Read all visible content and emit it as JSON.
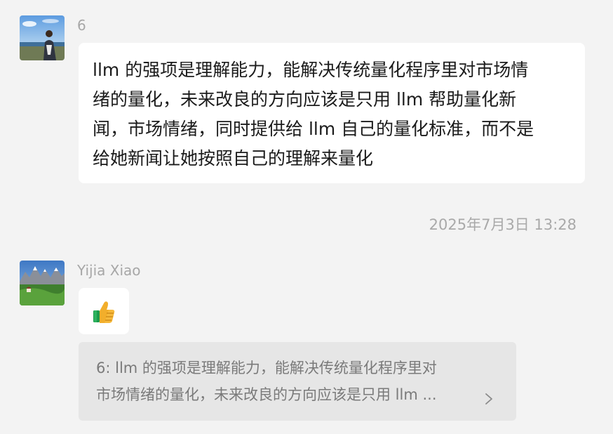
{
  "messages": [
    {
      "sender": "6",
      "text": "llm的强项是理解能力，能解决传统量化程序里对市场情绪的量化，未来改良的方向应该是只用 llm 帮助量化新闻，市场情绪，同时提供给 llm 自己的量化标准，而不是给她新闻让她按照自己的理解来量化",
      "lines": [
        "llm 的强项是理解能力，能解决传统量化程序里对市场情",
        "绪的量化，未来改良的方向应该是只用 llm 帮助量化新",
        "闻，市场情绪，同时提供给 llm 自己的量化标准，而不是",
        "给她新闻让她按照自己的理解来量化"
      ]
    }
  ],
  "timestamp": "2025年7月3日 13:28",
  "reply": {
    "sender": "Yijia Xiao",
    "emoji": "thumbs-up",
    "quote_lines": [
      "6: llm 的强项是理解能力，能解决传统量化程序里对",
      "市场情绪的量化，未来改良的方向应该是只用 llm ..."
    ],
    "quote_chevron": "chevron-right-icon"
  },
  "colors": {
    "background": "#f3f3f3",
    "bubble": "#ffffff",
    "quote_bg": "#e6e6e6",
    "muted_text": "#a7a7a7"
  }
}
